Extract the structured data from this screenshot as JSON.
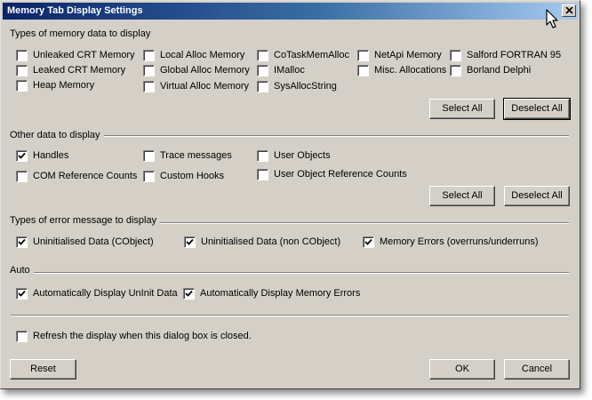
{
  "window": {
    "title": "Memory Tab Display Settings"
  },
  "memory_types": {
    "label": "Types of memory data to display",
    "items": [
      {
        "label": "Unleaked CRT Memory",
        "checked": false
      },
      {
        "label": "Leaked CRT Memory",
        "checked": false
      },
      {
        "label": "Heap Memory",
        "checked": false
      },
      {
        "label": "Local Alloc Memory",
        "checked": false
      },
      {
        "label": "Global Alloc Memory",
        "checked": false
      },
      {
        "label": "Virtual Alloc Memory",
        "checked": false
      },
      {
        "label": "CoTaskMemAlloc",
        "checked": false
      },
      {
        "label": "IMalloc",
        "checked": false
      },
      {
        "label": "SysAllocString",
        "checked": false
      },
      {
        "label": "NetApi Memory",
        "checked": false
      },
      {
        "label": "Misc. Allocations",
        "checked": false
      },
      {
        "label": "Salford FORTRAN 95",
        "checked": false
      },
      {
        "label": "Borland Delphi",
        "checked": false
      }
    ],
    "select_all": "Select All",
    "deselect_all": "Deselect All"
  },
  "other_data": {
    "label": "Other data to display",
    "items": [
      {
        "label": "Handles",
        "checked": true
      },
      {
        "label": "COM Reference Counts",
        "checked": false
      },
      {
        "label": "Trace messages",
        "checked": false
      },
      {
        "label": "Custom Hooks",
        "checked": false
      },
      {
        "label": "User Objects",
        "checked": false
      },
      {
        "label": "User Object Reference Counts",
        "checked": false
      }
    ],
    "select_all": "Select All",
    "deselect_all": "Deselect All"
  },
  "error_types": {
    "label": "Types of error message to display",
    "items": [
      {
        "label": "Uninitialised Data (CObject)",
        "checked": true
      },
      {
        "label": "Uninitialised Data (non CObject)",
        "checked": true
      },
      {
        "label": "Memory Errors (overruns/underruns)",
        "checked": true
      }
    ]
  },
  "auto": {
    "label": "Auto",
    "items": [
      {
        "label": "Automatically Display UnInit Data",
        "checked": true
      },
      {
        "label": "Automatically Display Memory Errors",
        "checked": true
      }
    ]
  },
  "refresh": {
    "label": "Refresh the display when this dialog box is closed.",
    "checked": false
  },
  "footer": {
    "reset": "Reset",
    "ok": "OK",
    "cancel": "Cancel"
  }
}
